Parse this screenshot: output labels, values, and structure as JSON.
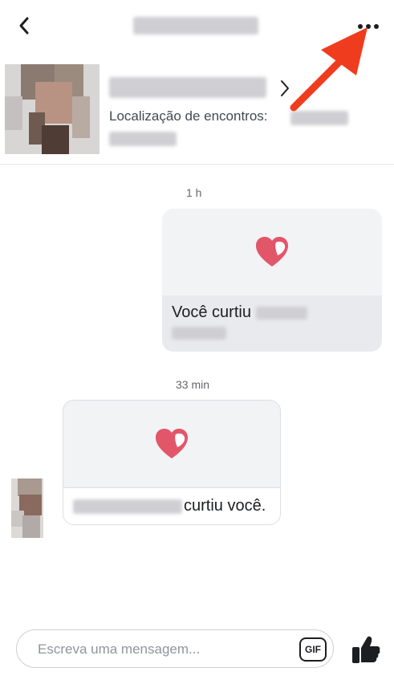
{
  "header": {
    "back_icon": "back-arrow-icon",
    "more_icon": "more-options-icon"
  },
  "profile": {
    "location_label": "Localização de encontros:"
  },
  "messages": [
    {
      "timestamp": "1 h",
      "text": "Você curtiu",
      "direction": "sent"
    },
    {
      "timestamp": "33 min",
      "text": "curtiu você.",
      "direction": "received"
    }
  ],
  "composer": {
    "placeholder": "Escreva uma mensagem...",
    "gif_label": "GIF",
    "like_icon": "thumbs-up-icon"
  },
  "colors": {
    "heart": "#e2566a",
    "arrow": "#f03c1e",
    "text": "#1c1e21",
    "bubble": "#f2f3f5"
  }
}
